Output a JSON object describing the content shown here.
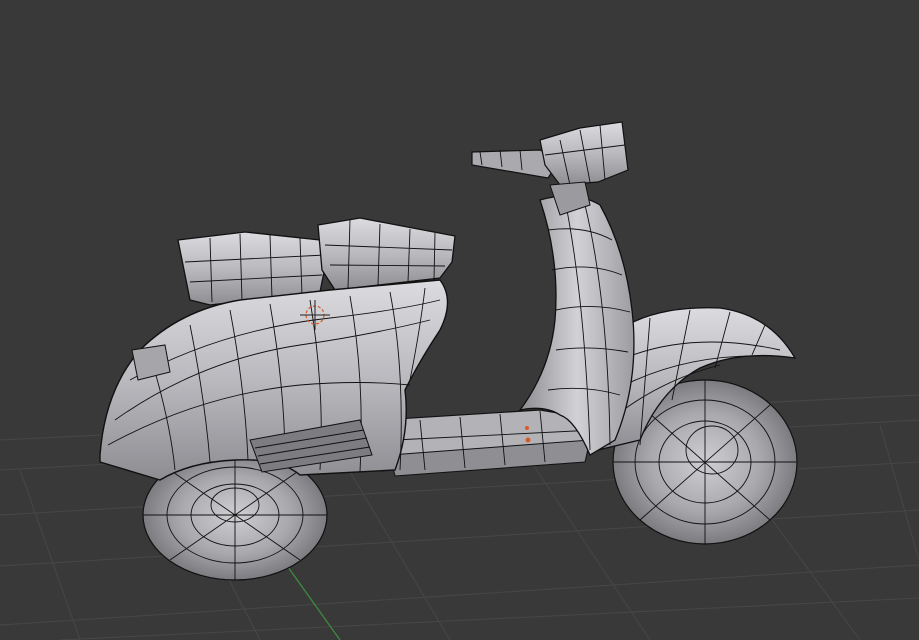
{
  "viewport": {
    "background_color": "#393939",
    "grid_color": "#474747",
    "x_axis_color": "#8a3a3a",
    "y_axis_color": "#3f8f3f",
    "mesh_color": "#c4c4c8",
    "wire_color": "#111111",
    "cursor_color": "#d85a2a"
  },
  "scene": {
    "object": "scooter-mesh",
    "shading": "solid-with-wireframe",
    "grid_floor": true
  }
}
